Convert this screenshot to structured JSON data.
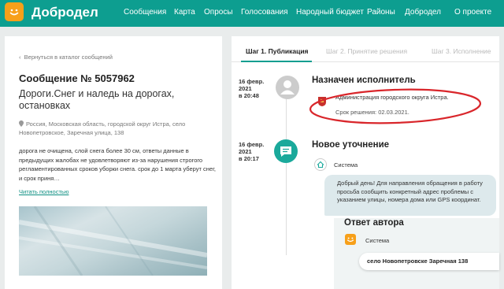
{
  "header": {
    "brand": "Добродел",
    "nav": [
      "Сообщения",
      "Карта",
      "Опросы",
      "Голосования",
      "Народный бюджет",
      "Районы",
      "Добродел",
      "О проекте"
    ]
  },
  "message": {
    "back_link": "Вернуться в каталог сообщений",
    "title": "Сообщение № 5057962",
    "subtitle": "Дороги.Снег и наледь на дорогах, остановках",
    "location": "Россия, Московская область, городской округ Истра, село Новопетровское, Заречная улица, 138",
    "body": "дорога не очищена, слой снега более 30 см, ответы данные в предыдущих жалобах не удовлетворяют из-за нарушения строгого регламентированных сроков уборки снега. срок до 1 марта уберут снег, и срок приня…",
    "read_all": "Читать полностью"
  },
  "tabs": {
    "step1": "Шаг 1. Публикация",
    "step2": "Шаг 2. Принятие решения",
    "step3": "Шаг 3. Исполнение"
  },
  "events": [
    {
      "date_line1": "16 февр.",
      "date_line2": "2021",
      "date_line3": "в 20:48",
      "title": "Назначен исполнитель",
      "org": "Администрация городского округа Истра.",
      "deadline": "Срок решения: 02.03.2021."
    },
    {
      "date_line1": "16 февр.",
      "date_line2": "2021",
      "date_line3": "в 20:17",
      "title": "Новое уточнение",
      "sender": "Система",
      "text": "Добрый день! Для направления обращения в работу просьба сообщить конкретный адрес проблемы с указанием улицы, номера дома или GPS координат."
    }
  ],
  "author_answer": {
    "title": "Ответ автора",
    "sender": "Система",
    "address": "село Новопетровске Заречная 138"
  },
  "colors": {
    "brand_teal": "#0d9e90",
    "logo_orange": "#f7a01a",
    "highlight_red": "#d9262b"
  },
  "icons": [
    "logo-smile-icon",
    "location-pin-icon",
    "user-avatar-icon",
    "chat-bubble-icon",
    "org-emblem-icon",
    "system-home-icon"
  ]
}
